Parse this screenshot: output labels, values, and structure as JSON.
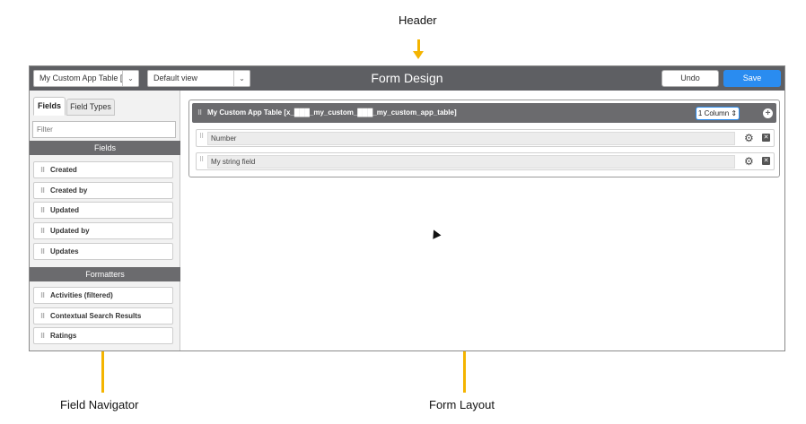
{
  "annotations": {
    "header": "Header",
    "field_navigator": "Field Navigator",
    "form_layout": "Form Layout"
  },
  "topbar": {
    "table_select": "My Custom App Table [x_s",
    "view_select": "Default view",
    "title": "Form Design",
    "undo_label": "Undo",
    "save_label": "Save"
  },
  "navigator": {
    "tabs": [
      "Fields",
      "Field Types"
    ],
    "filter_placeholder": "Filter",
    "fields_header": "Fields",
    "fields": [
      "Created",
      "Created by",
      "Updated",
      "Updated by",
      "Updates"
    ],
    "formatters_header": "Formatters",
    "formatters": [
      "Activities (filtered)",
      "Contextual Search Results",
      "Ratings"
    ]
  },
  "form": {
    "section_title": "My Custom App Table [x_███_my_custom_███_my_custom_app_table]",
    "column_select": "1 Column",
    "rows": [
      "Number",
      "My string field"
    ]
  },
  "colors": {
    "accent": "#2a8cf0",
    "header_bg": "#5e5f63",
    "arrow": "#f4b400"
  }
}
